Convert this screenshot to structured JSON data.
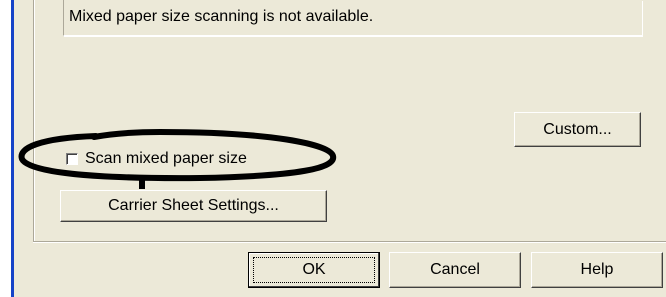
{
  "info": {
    "message": "Mixed paper size scanning is not available."
  },
  "buttons": {
    "custom": "Custom...",
    "carrier_sheet": "Carrier Sheet Settings...",
    "ok": "OK",
    "cancel": "Cancel",
    "help": "Help"
  },
  "scan_mixed": {
    "label": "Scan mixed paper size",
    "checked": false
  }
}
